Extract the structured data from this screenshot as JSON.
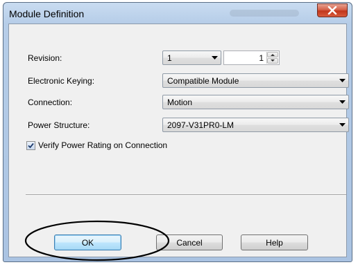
{
  "dialog": {
    "title": "Module Definition",
    "close_icon": "close-icon"
  },
  "fields": {
    "revision_label": "Revision:",
    "revision_major": "1",
    "revision_minor": "1",
    "keying_label": "Electronic Keying:",
    "keying_value": "Compatible Module",
    "connection_label": "Connection:",
    "connection_value": "Motion",
    "power_label": "Power Structure:",
    "power_value": "2097-V31PR0-LM",
    "verify_label": "Verify Power Rating on Connection",
    "verify_checked": true
  },
  "buttons": {
    "ok": "OK",
    "cancel": "Cancel",
    "help": "Help"
  },
  "colors": {
    "title_gradient": "#c9dcf1",
    "close_red": "#c1361c",
    "ok_highlight": "#bee6fd",
    "annotation_stroke": "#000000"
  }
}
